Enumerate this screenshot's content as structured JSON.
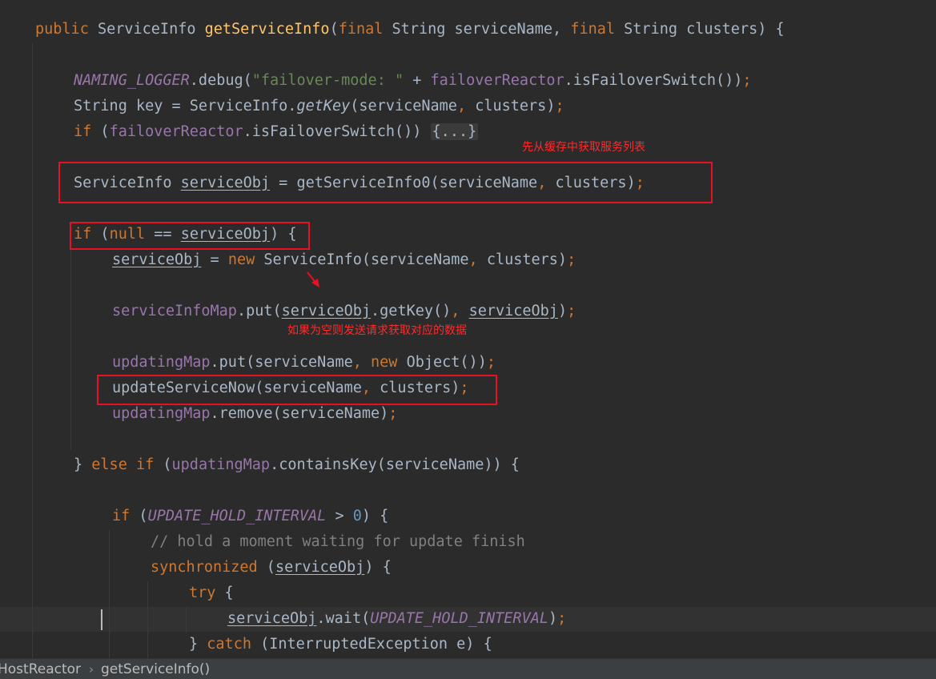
{
  "annotations": {
    "note_cache": "先从缓存中获取服务列表",
    "note_request": "如果为空则发送请求获取对应的数据"
  },
  "breadcrumb": {
    "items": [
      "HostReactor",
      "getServiceInfo()"
    ],
    "separator_icon": "chevron-right-icon"
  },
  "colors": {
    "background": "#2b2b2b",
    "keyword": "#cc7832",
    "method": "#ffc66d",
    "field": "#9876aa",
    "string": "#6a8759",
    "number": "#6897bb",
    "comment": "#808080",
    "annotation": "#e81123"
  },
  "fold_placeholder": "{...}"
}
